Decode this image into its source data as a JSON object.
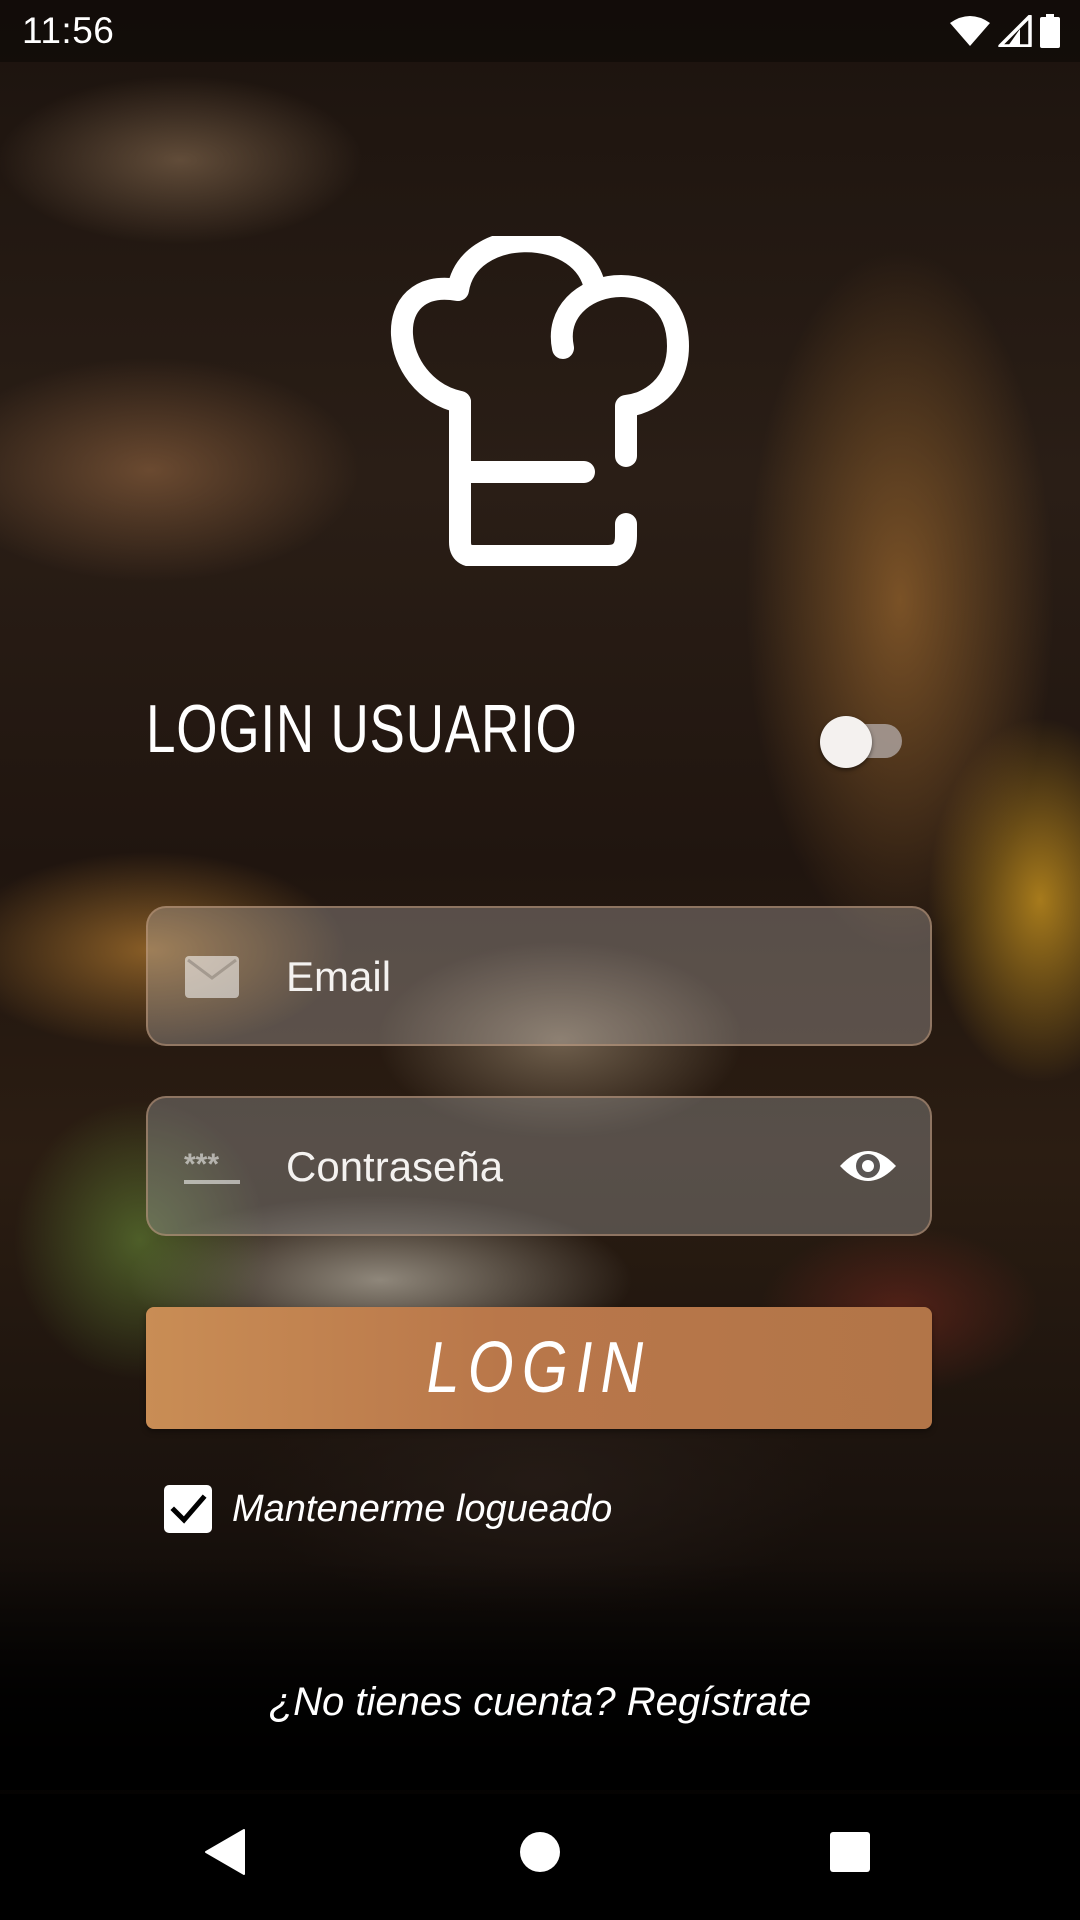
{
  "status_bar": {
    "time": "11:56",
    "icons": [
      "wifi-icon",
      "cell-signal-icon",
      "battery-icon"
    ]
  },
  "logo": {
    "icon": "chef-hat-icon"
  },
  "header": {
    "title": "LOGIN USUARIO",
    "toggle_on": false
  },
  "form": {
    "email": {
      "placeholder": "Email",
      "value": "",
      "icon": "mail-icon"
    },
    "password": {
      "placeholder": "Contraseña",
      "value": "",
      "icon": "password-dots-icon",
      "toggle_icon": "eye-icon"
    },
    "login_label": "LOGIN",
    "remember": {
      "label": "Mantenerme logueado",
      "checked": true
    }
  },
  "footer": {
    "register_text": "¿No tienes cuenta? Regístrate"
  },
  "nav_bar": {
    "buttons": [
      "back-icon",
      "home-icon",
      "recents-icon"
    ]
  },
  "colors": {
    "accent": "#b9774a",
    "text": "#ffffff"
  }
}
